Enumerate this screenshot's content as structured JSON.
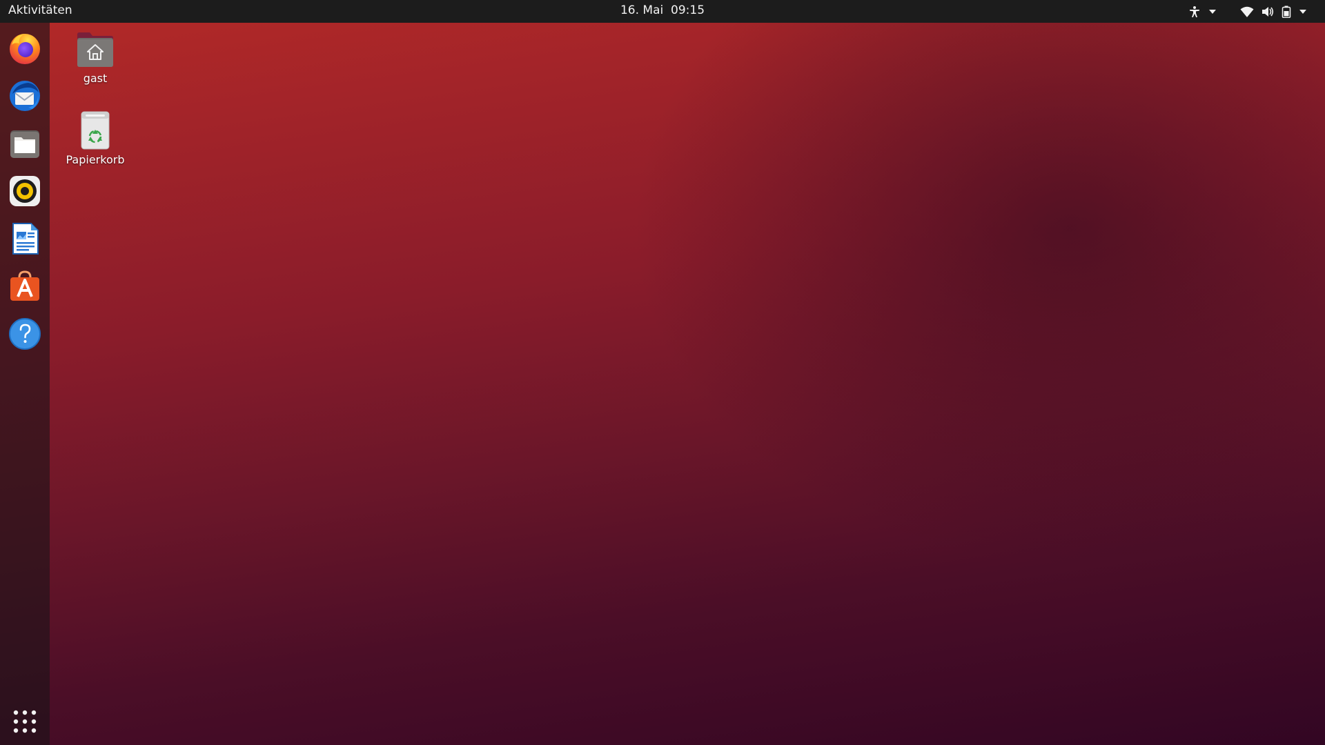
{
  "topbar": {
    "activities_label": "Aktivitäten",
    "clock": "16. Mai  09:15",
    "tray_icons": [
      "accessibility-icon",
      "chevron-down-icon",
      "wifi-icon",
      "volume-icon",
      "battery-icon",
      "chevron-down-icon"
    ]
  },
  "dock": {
    "apps": [
      {
        "name": "Firefox",
        "icon": "firefox-icon"
      },
      {
        "name": "Thunderbird",
        "icon": "thunderbird-icon"
      },
      {
        "name": "Dateien",
        "icon": "files-icon"
      },
      {
        "name": "Rhythmbox",
        "icon": "rhythmbox-icon"
      },
      {
        "name": "LibreOffice Writer",
        "icon": "writer-icon"
      },
      {
        "name": "Ubuntu Software",
        "icon": "software-icon"
      },
      {
        "name": "Hilfe",
        "icon": "help-icon"
      }
    ],
    "show_apps_icon": "app-grid-icon"
  },
  "desktop": {
    "icons": [
      {
        "label": "gast",
        "icon": "home-folder-icon"
      },
      {
        "label": "Papierkorb",
        "icon": "trash-icon"
      }
    ]
  },
  "colors": {
    "topbar": "#1c1c1c",
    "wallpaper_top": "#b52a28",
    "wallpaper_bottom": "#320623",
    "ubuntu_orange": "#e95420"
  }
}
